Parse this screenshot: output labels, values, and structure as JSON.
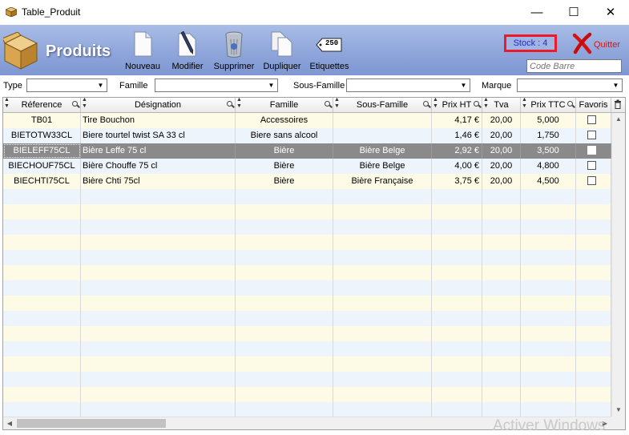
{
  "window": {
    "title": "Table_Produit",
    "min_label": "—",
    "max_label": "☐",
    "close_label": "✕"
  },
  "header": {
    "title": "Produits",
    "stock_label": "Stock : 4",
    "quit_label": "Quitter",
    "codebarre_placeholder": "Code Barre"
  },
  "toolbar": {
    "nouveau": "Nouveau",
    "modifier": "Modifier",
    "supprimer": "Supprimer",
    "dupliquer": "Dupliquer",
    "etiquettes": "Etiquettes",
    "etiquette_tag": "250"
  },
  "filters": {
    "type_label": "Type",
    "famille_label": "Famille",
    "sousfamille_label": "Sous-Famille",
    "marque_label": "Marque",
    "type_value": "",
    "famille_value": "",
    "sousfamille_value": "",
    "marque_value": ""
  },
  "table": {
    "columns": [
      "Réference",
      "Désignation",
      "Famille",
      "Sous-Famille",
      "Prix HT",
      "Tva",
      "Prix TTC",
      "Favoris"
    ],
    "rows": [
      {
        "ref": "TB01",
        "designation": "Tire Bouchon",
        "famille": "Accessoires",
        "sousfamille": "",
        "prix_ht": "4,17 €",
        "tva": "20,00",
        "prix_ttc": "5,000",
        "favoris": false
      },
      {
        "ref": "BIETOTW33CL",
        "designation": "Biere tourtel twist SA 33 cl",
        "famille": "Biere sans alcool",
        "sousfamille": "",
        "prix_ht": "1,46 €",
        "tva": "20,00",
        "prix_ttc": "1,750",
        "favoris": false
      },
      {
        "ref": "BIELEFF75CL",
        "designation": "Bière Leffe 75 cl",
        "famille": "Bière",
        "sousfamille": "Bière Belge",
        "prix_ht": "2,92 €",
        "tva": "20,00",
        "prix_ttc": "3,500",
        "favoris": false
      },
      {
        "ref": "BIECHOUF75CL",
        "designation": "Bière Chouffe 75 cl",
        "famille": "Bière",
        "sousfamille": "Bière Belge",
        "prix_ht": "4,00 €",
        "tva": "20,00",
        "prix_ttc": "4,800",
        "favoris": false
      },
      {
        "ref": "BIECHTI75CL",
        "designation": "Bière Chti 75cl",
        "famille": "Bière",
        "sousfamille": "Bière Française",
        "prix_ht": "3,75 €",
        "tva": "20,00",
        "prix_ttc": "4,500",
        "favoris": false
      }
    ],
    "selected_row": 2
  },
  "watermark": "Activer Windows",
  "colors": {
    "band": "#8fa6db",
    "stock_border": "#ea1c2c",
    "stock_text": "#1c2bd0",
    "quit_text": "#d01818",
    "selected_row": "#8a8a8a"
  }
}
